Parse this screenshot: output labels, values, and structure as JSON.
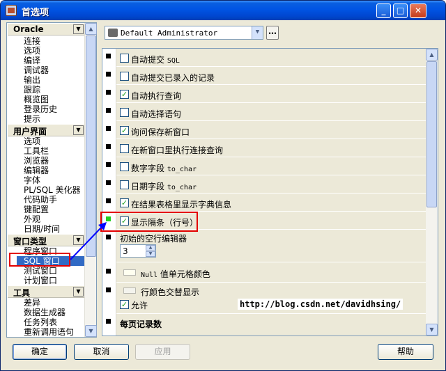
{
  "window": {
    "title": "首选项"
  },
  "left_tree": {
    "sections": [
      {
        "label": "Oracle",
        "items": [
          "连接",
          "选项",
          "编译",
          "调试器",
          "输出",
          "跟踪",
          "概览图",
          "登录历史",
          "提示"
        ]
      },
      {
        "label": "用户界面",
        "items": [
          "选项",
          "工具栏",
          "浏览器",
          "编辑器",
          "字体",
          "PL/SQL 美化器",
          "代码助手",
          "键配置",
          "外观",
          "日期/时间"
        ]
      },
      {
        "label": "窗口类型",
        "items": [
          "程序窗口",
          "SQL 窗口",
          "测试窗口",
          "计划窗口"
        ],
        "selected": "SQL 窗口"
      },
      {
        "label": "工具",
        "items": [
          "差异",
          "数据生成器",
          "任务列表",
          "重新调用语句"
        ]
      }
    ]
  },
  "profile": {
    "value": "Default Administrator"
  },
  "options": {
    "auto_commit": {
      "label": "自动提交",
      "suffix": "SQL",
      "checked": false
    },
    "auto_commit_entered": {
      "label": "自动提交已录入的记录",
      "checked": false
    },
    "auto_exec_query": {
      "label": "自动执行查询",
      "checked": true
    },
    "auto_select_stmt": {
      "label": "自动选择语句",
      "checked": false
    },
    "ask_save_new": {
      "label": "询问保存新窗口",
      "checked": true
    },
    "exec_conn_query": {
      "label": "在新窗口里执行连接查询",
      "checked": false
    },
    "number_field": {
      "label": "数字字段",
      "suffix": "to_char",
      "checked": false
    },
    "date_field": {
      "label": "日期字段",
      "suffix": "to_char",
      "checked": false
    },
    "dict_info": {
      "label": "在结果表格里显示字典信息",
      "checked": true
    },
    "gridlines": {
      "label": "显示隔条（行号）",
      "checked": true
    },
    "empty_rows": {
      "label": "初始的空行编辑器",
      "value": "3"
    },
    "null_color": {
      "label_prefix": "Null",
      "label": "值单元格颜色"
    },
    "alt_row_color": {
      "label": "行颜色交替显示",
      "allow_label": "允许",
      "allow_checked": true
    },
    "records_per_page": {
      "label": "每页记录数"
    }
  },
  "watermark": {
    "text": "http://blog.csdn.net/davidhsing/"
  },
  "buttons": {
    "ok": "确定",
    "cancel": "取消",
    "apply": "应用",
    "help": "帮助"
  },
  "colors": {
    "annotation": "#e30000",
    "arrow": "#0000ff",
    "selection": "#316ac5"
  }
}
